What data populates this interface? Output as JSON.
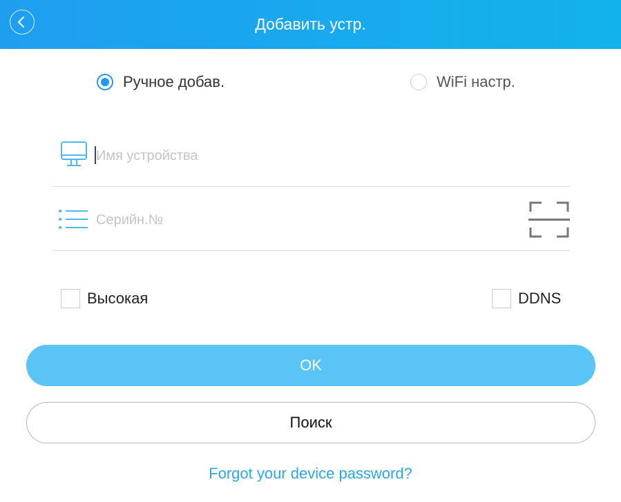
{
  "header": {
    "title": "Добавить устр.",
    "back_icon": "back-chevron-icon"
  },
  "mode_options": [
    {
      "label": "Ручное добав.",
      "selected": true
    },
    {
      "label": "WiFi настр.",
      "selected": false
    }
  ],
  "fields": {
    "device_name": {
      "placeholder": "Имя устройства",
      "value": "",
      "icon": "monitor-icon"
    },
    "serial": {
      "placeholder": "Серийн.№",
      "value": "",
      "icon": "list-icon",
      "scan_icon": "qr-scan-icon"
    }
  },
  "checkboxes": [
    {
      "label": "Высокая",
      "checked": false
    },
    {
      "label": "DDNS",
      "checked": false
    }
  ],
  "buttons": {
    "ok_label": "OK",
    "search_label": "Поиск"
  },
  "forgot_link": "Forgot your device password?",
  "colors": {
    "header": "#1f9ef0",
    "accent": "#2196f3",
    "ok_button": "#5bc4f6",
    "link": "#2aa7ea",
    "icon_blue": "#4fb8ee"
  }
}
